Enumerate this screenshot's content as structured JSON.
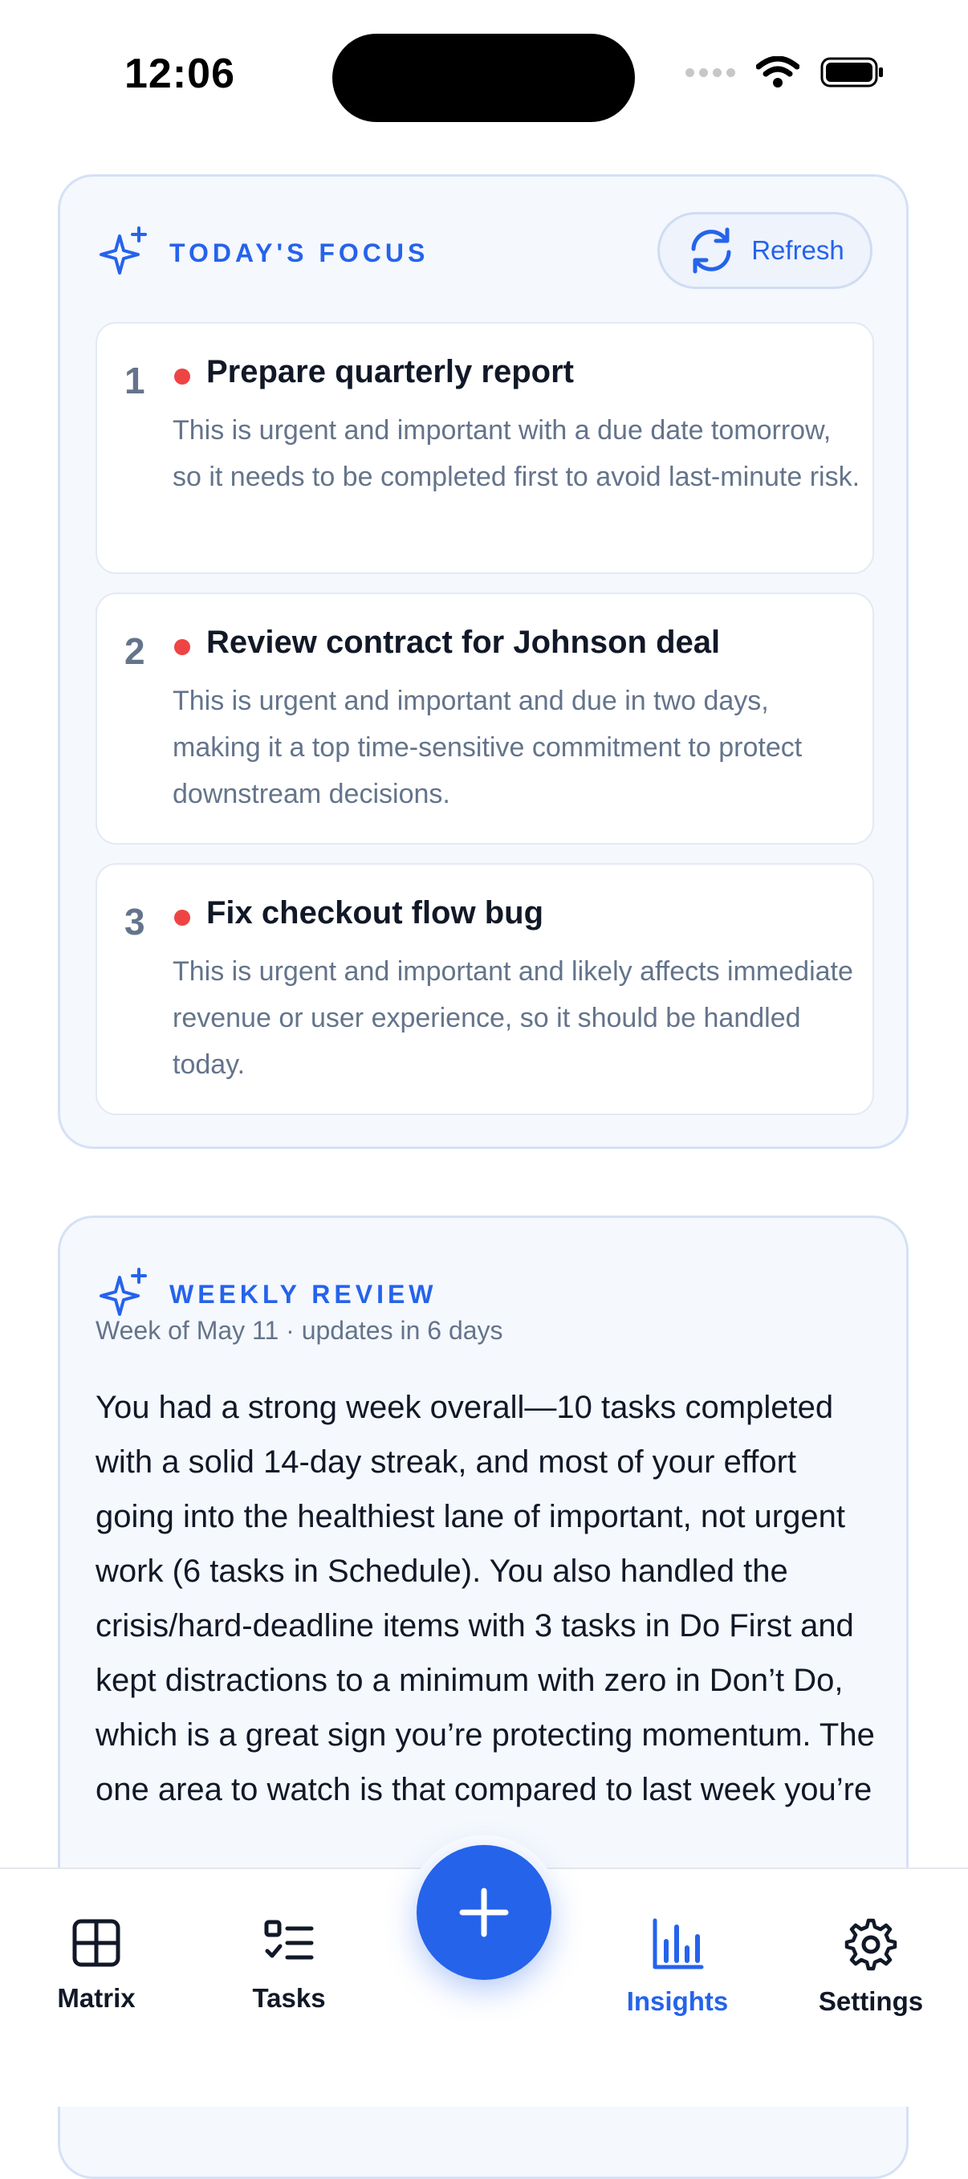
{
  "status_bar": {
    "time": "12:06"
  },
  "focus": {
    "title": "TODAY'S FOCUS",
    "refresh_label": "Refresh",
    "items": [
      {
        "num": "1",
        "title": "Prepare quarterly report",
        "desc": "This is urgent and important with a due date tomorrow, so it needs to be completed first to avoid last-minute risk."
      },
      {
        "num": "2",
        "title": "Review contract for Johnson deal",
        "desc": "This is urgent and important and due in two days, making it a top time-sensitive commitment to protect downstream decisions."
      },
      {
        "num": "3",
        "title": "Fix checkout flow bug",
        "desc": "This is urgent and important and likely affects immediate revenue or user experience, so it should be handled today."
      }
    ]
  },
  "weekly": {
    "title": "WEEKLY REVIEW",
    "subtitle": "Week of May 11 · updates in 6 days",
    "body": "You had a strong week overall—10 tasks completed with a solid 14-day streak, and most of your effort going into the healthiest lane of important, not urgent work (6 tasks in Schedule). You also handled the crisis/hard-deadline items with 3 tasks in Do First and kept distractions to a minimum with zero in Don’t Do, which is a great sign you’re protecting momentum. The one area to watch is that compared to last week you’re"
  },
  "tabs": [
    {
      "label": "Matrix",
      "icon": "grid-icon"
    },
    {
      "label": "Tasks",
      "icon": "checklist-icon"
    },
    {
      "label": "Insights",
      "icon": "bar-chart-icon"
    },
    {
      "label": "Settings",
      "icon": "gear-icon"
    }
  ],
  "colors": {
    "accent": "#2563eb",
    "priority_dot": "#ef4444"
  }
}
